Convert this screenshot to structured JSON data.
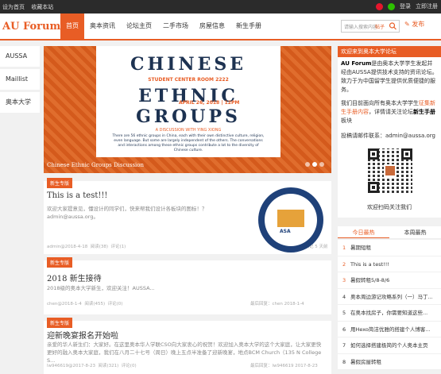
{
  "topbar": {
    "set_home": "设为首页",
    "bookmark": "收藏本站",
    "login": "登录",
    "register": "立即注册"
  },
  "nav": {
    "logo": "AU Forum",
    "items": [
      "首页",
      "奥本资讯",
      "论坛主页",
      "二手市场",
      "房屋信息",
      "新生手册"
    ],
    "search_placeholder": "请输入搜索内容",
    "search_tag": "帖子",
    "publish": "发布"
  },
  "leftnav": [
    "AUSSA",
    "Maillist",
    "奥本大学"
  ],
  "slider": {
    "caption": "Chinese Ethnic Groups Discussion",
    "poster": {
      "line1": "CHINESE",
      "location": "STUDENT CENTER ROOM 2222",
      "line2": "ETHNIC",
      "date": "APRIL 26, 2018 | 12PM",
      "line3": "GROUPS",
      "subtitle": "A DISCUSSION WITH YING XIONG",
      "body": "There are 56 ethnic groups in China, each with their own distinctive culture, religion, even language. But some are largely independent of the others. The conversations and interactions among these ethnic groups contribute a lot to the diversity of Chinese culture."
    }
  },
  "posts": [
    {
      "badge": "新生专版",
      "title": "This is a test!!!",
      "desc": "欢迎大家提意见，懂设计的同学们，快来帮我们设计各板块的图标！？ admin@aussa.org。",
      "author": "admin",
      "date": "2018-4-18",
      "views": "阅读(38)",
      "comments": "评论(1)",
      "last_reply": "最后回复：奥本歌记 5 天前",
      "seal_text": "ASA"
    },
    {
      "badge": "新生专版",
      "title": "2018 新生接待",
      "desc": "2018级的奥本大学新生，欢迎关注！AUSSA...",
      "author": "chen",
      "date": "2018-1-4",
      "views": "阅读(455)",
      "comments": "评论(0)",
      "last_reply": "最后回复：chen 2018-1-4"
    },
    {
      "badge": "新生专版",
      "title": "迎新晚宴报名开始啦",
      "desc": "亲爱的华人新生们：大家好。在这里奥本华人学联CSO向大家衷心的祝贺！欢迎加入奥本大学的这个大家庭，让大家更快更好的融入奥本大家庭，我们在八月二十七号（周日）晚上五点半准备了迎新晚宴，地点BCM Church（135 N College S...",
      "author": "lw946619",
      "date": "2017-8-23",
      "views": "阅读(321)",
      "comments": "评论(0)",
      "last_reply": "最后回复：lw946619 2017-8-23"
    }
  ],
  "sidebar": {
    "head": "欢迎来到奥本大学论坛",
    "intro_bold": "AU Forum",
    "intro": "是由奥本大学学生发起并经由AUSSA提供技术支持的资讯论坛。致力于为中国留学生提供优质便捷的服务。",
    "intro2_pre": "我们目前面向所有奥本大学学生",
    "intro2_link": "征集新生手册内容",
    "intro2_post": "，详情请关注论坛",
    "intro2_bold": "新生手册",
    "intro2_end": "板块",
    "email_label": "投稿请邮件联系：",
    "email": "admin@aussa.org",
    "qr_caption": "欢迎扫码关注我们"
  },
  "tabs": [
    "今日最热",
    "本周最热"
  ],
  "ranklist": [
    {
      "n": "1",
      "title": "暑期短租"
    },
    {
      "n": "2",
      "title": "This is a test!!!"
    },
    {
      "n": "3",
      "title": "暑假转租5/8-8/6"
    },
    {
      "n": "4",
      "title": "奥本周边游记攻略系列（一）马丁..."
    },
    {
      "n": "5",
      "title": "在奥本找房子，你需要知道这些..."
    },
    {
      "n": "6",
      "title": "用Hexo简洁优雅的搭建个人博客..."
    },
    {
      "n": "7",
      "title": "如何选择搭建极简的个人奥本主页"
    },
    {
      "n": "8",
      "title": "暑假房屋转租"
    }
  ],
  "colors": {
    "accent": "#e85d25",
    "topbar": "#2b2b2b",
    "navy": "#1d3251"
  }
}
